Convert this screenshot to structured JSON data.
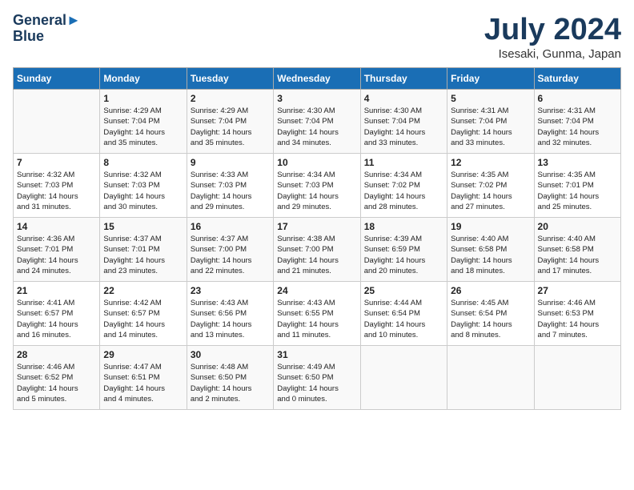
{
  "header": {
    "logo_line1": "General",
    "logo_line2": "Blue",
    "month_title": "July 2024",
    "subtitle": "Isesaki, Gunma, Japan"
  },
  "days_of_week": [
    "Sunday",
    "Monday",
    "Tuesday",
    "Wednesday",
    "Thursday",
    "Friday",
    "Saturday"
  ],
  "weeks": [
    [
      {
        "day": "",
        "info": ""
      },
      {
        "day": "1",
        "info": "Sunrise: 4:29 AM\nSunset: 7:04 PM\nDaylight: 14 hours\nand 35 minutes."
      },
      {
        "day": "2",
        "info": "Sunrise: 4:29 AM\nSunset: 7:04 PM\nDaylight: 14 hours\nand 35 minutes."
      },
      {
        "day": "3",
        "info": "Sunrise: 4:30 AM\nSunset: 7:04 PM\nDaylight: 14 hours\nand 34 minutes."
      },
      {
        "day": "4",
        "info": "Sunrise: 4:30 AM\nSunset: 7:04 PM\nDaylight: 14 hours\nand 33 minutes."
      },
      {
        "day": "5",
        "info": "Sunrise: 4:31 AM\nSunset: 7:04 PM\nDaylight: 14 hours\nand 33 minutes."
      },
      {
        "day": "6",
        "info": "Sunrise: 4:31 AM\nSunset: 7:04 PM\nDaylight: 14 hours\nand 32 minutes."
      }
    ],
    [
      {
        "day": "7",
        "info": "Sunrise: 4:32 AM\nSunset: 7:03 PM\nDaylight: 14 hours\nand 31 minutes."
      },
      {
        "day": "8",
        "info": "Sunrise: 4:32 AM\nSunset: 7:03 PM\nDaylight: 14 hours\nand 30 minutes."
      },
      {
        "day": "9",
        "info": "Sunrise: 4:33 AM\nSunset: 7:03 PM\nDaylight: 14 hours\nand 29 minutes."
      },
      {
        "day": "10",
        "info": "Sunrise: 4:34 AM\nSunset: 7:03 PM\nDaylight: 14 hours\nand 29 minutes."
      },
      {
        "day": "11",
        "info": "Sunrise: 4:34 AM\nSunset: 7:02 PM\nDaylight: 14 hours\nand 28 minutes."
      },
      {
        "day": "12",
        "info": "Sunrise: 4:35 AM\nSunset: 7:02 PM\nDaylight: 14 hours\nand 27 minutes."
      },
      {
        "day": "13",
        "info": "Sunrise: 4:35 AM\nSunset: 7:01 PM\nDaylight: 14 hours\nand 25 minutes."
      }
    ],
    [
      {
        "day": "14",
        "info": "Sunrise: 4:36 AM\nSunset: 7:01 PM\nDaylight: 14 hours\nand 24 minutes."
      },
      {
        "day": "15",
        "info": "Sunrise: 4:37 AM\nSunset: 7:01 PM\nDaylight: 14 hours\nand 23 minutes."
      },
      {
        "day": "16",
        "info": "Sunrise: 4:37 AM\nSunset: 7:00 PM\nDaylight: 14 hours\nand 22 minutes."
      },
      {
        "day": "17",
        "info": "Sunrise: 4:38 AM\nSunset: 7:00 PM\nDaylight: 14 hours\nand 21 minutes."
      },
      {
        "day": "18",
        "info": "Sunrise: 4:39 AM\nSunset: 6:59 PM\nDaylight: 14 hours\nand 20 minutes."
      },
      {
        "day": "19",
        "info": "Sunrise: 4:40 AM\nSunset: 6:58 PM\nDaylight: 14 hours\nand 18 minutes."
      },
      {
        "day": "20",
        "info": "Sunrise: 4:40 AM\nSunset: 6:58 PM\nDaylight: 14 hours\nand 17 minutes."
      }
    ],
    [
      {
        "day": "21",
        "info": "Sunrise: 4:41 AM\nSunset: 6:57 PM\nDaylight: 14 hours\nand 16 minutes."
      },
      {
        "day": "22",
        "info": "Sunrise: 4:42 AM\nSunset: 6:57 PM\nDaylight: 14 hours\nand 14 minutes."
      },
      {
        "day": "23",
        "info": "Sunrise: 4:43 AM\nSunset: 6:56 PM\nDaylight: 14 hours\nand 13 minutes."
      },
      {
        "day": "24",
        "info": "Sunrise: 4:43 AM\nSunset: 6:55 PM\nDaylight: 14 hours\nand 11 minutes."
      },
      {
        "day": "25",
        "info": "Sunrise: 4:44 AM\nSunset: 6:54 PM\nDaylight: 14 hours\nand 10 minutes."
      },
      {
        "day": "26",
        "info": "Sunrise: 4:45 AM\nSunset: 6:54 PM\nDaylight: 14 hours\nand 8 minutes."
      },
      {
        "day": "27",
        "info": "Sunrise: 4:46 AM\nSunset: 6:53 PM\nDaylight: 14 hours\nand 7 minutes."
      }
    ],
    [
      {
        "day": "28",
        "info": "Sunrise: 4:46 AM\nSunset: 6:52 PM\nDaylight: 14 hours\nand 5 minutes."
      },
      {
        "day": "29",
        "info": "Sunrise: 4:47 AM\nSunset: 6:51 PM\nDaylight: 14 hours\nand 4 minutes."
      },
      {
        "day": "30",
        "info": "Sunrise: 4:48 AM\nSunset: 6:50 PM\nDaylight: 14 hours\nand 2 minutes."
      },
      {
        "day": "31",
        "info": "Sunrise: 4:49 AM\nSunset: 6:50 PM\nDaylight: 14 hours\nand 0 minutes."
      },
      {
        "day": "",
        "info": ""
      },
      {
        "day": "",
        "info": ""
      },
      {
        "day": "",
        "info": ""
      }
    ]
  ]
}
